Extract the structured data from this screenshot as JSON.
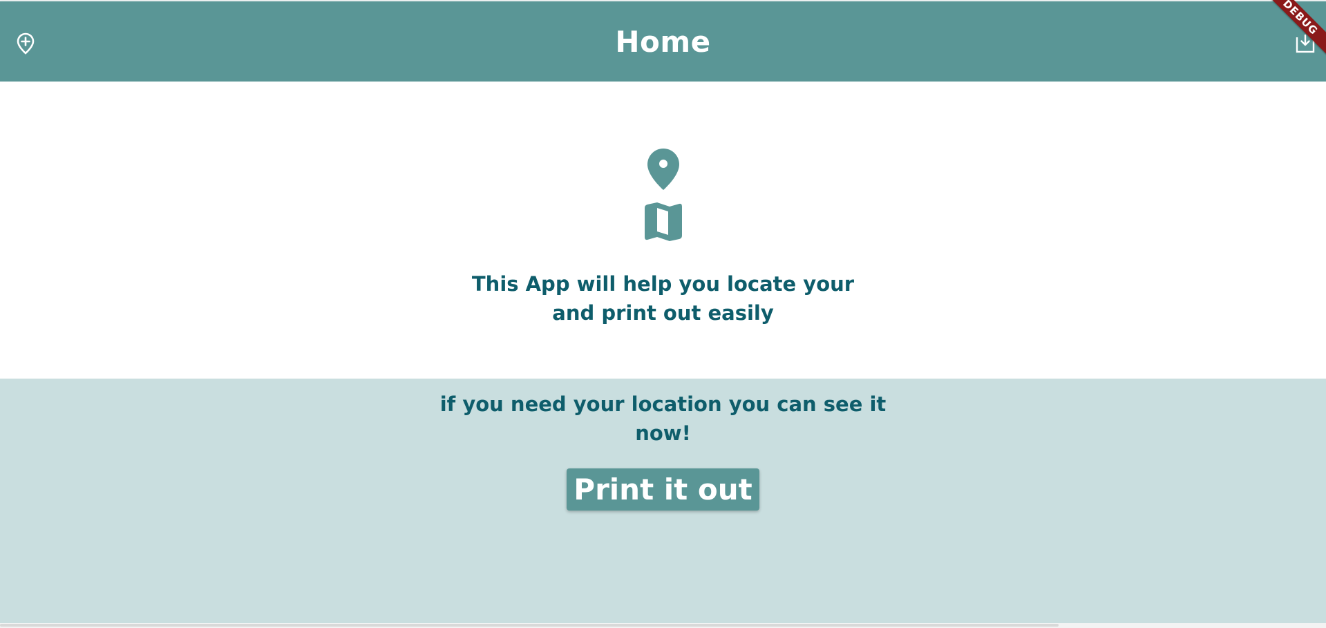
{
  "app": {
    "theme": {
      "primary": "#5a9696",
      "text_dark": "#0e5d6b",
      "panel_background": "#c9dedf",
      "debug_banner": "#8a1a1a"
    }
  },
  "appbar": {
    "title": "Home",
    "leading_icon": "add-location-icon",
    "trailing_icon": "print-export-icon",
    "debug_label": "DEBUG"
  },
  "hero": {
    "icons": [
      "location-pin-icon",
      "map-icon"
    ],
    "intro_line1": "This App will help you locate your",
    "intro_line2": "and print out easily"
  },
  "bottom": {
    "hint_line1": "if you need your location you can see it",
    "hint_line2": "now!",
    "print_button_label": "Print it out"
  }
}
